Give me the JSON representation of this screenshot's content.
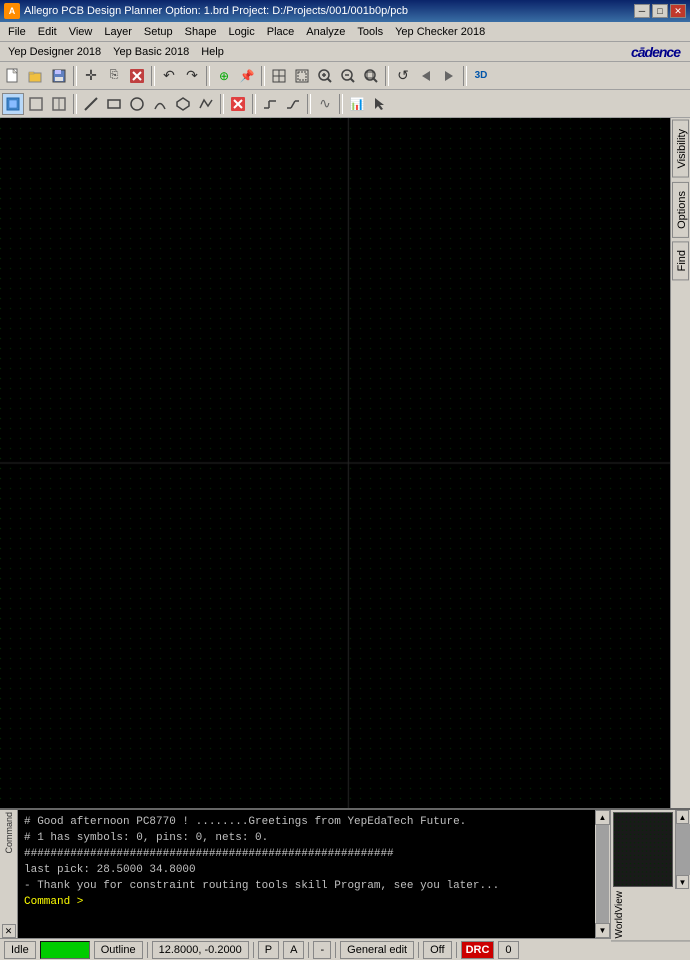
{
  "titlebar": {
    "title": "Allegro PCB Design Planner Option: 1.brd  Project: D:/Projects/001/001b0p/pcb",
    "icon_label": "A",
    "btn_minimize": "─",
    "btn_maximize": "□",
    "btn_close": "✕"
  },
  "menubar1": {
    "items": [
      "File",
      "Edit",
      "View",
      "Layer",
      "Setup",
      "Shape",
      "Logic",
      "Place",
      "Analyze",
      "Tools",
      "Yep Checker 2018"
    ]
  },
  "menubar2": {
    "items": [
      "Yep Designer 2018",
      "Yep Basic 2018",
      "Help"
    ],
    "logo": "cādence"
  },
  "toolbar1": {
    "buttons": [
      {
        "name": "new-btn",
        "icon": "📄",
        "label": "New"
      },
      {
        "name": "open-btn",
        "icon": "📂",
        "label": "Open"
      },
      {
        "name": "save-btn",
        "icon": "💾",
        "label": "Save"
      },
      {
        "name": "sep1",
        "icon": "",
        "label": ""
      },
      {
        "name": "move-btn",
        "icon": "✛",
        "label": "Move"
      },
      {
        "name": "copy-btn",
        "icon": "⎘",
        "label": "Copy"
      },
      {
        "name": "delete-btn",
        "icon": "✕",
        "label": "Delete"
      },
      {
        "name": "sep2",
        "icon": "",
        "label": ""
      },
      {
        "name": "undo-btn",
        "icon": "↶",
        "label": "Undo"
      },
      {
        "name": "redo-btn",
        "icon": "↷",
        "label": "Redo"
      },
      {
        "name": "sep3",
        "icon": "",
        "label": ""
      },
      {
        "name": "snap-btn",
        "icon": "⊕",
        "label": "Snap"
      },
      {
        "name": "pin-btn",
        "icon": "📌",
        "label": "Pin"
      },
      {
        "name": "sep4",
        "icon": "",
        "label": ""
      },
      {
        "name": "zoom-fit-btn",
        "icon": "⊞",
        "label": "Zoom Fit"
      },
      {
        "name": "zoom-in2-btn",
        "icon": "⊡",
        "label": "Zoom In"
      },
      {
        "name": "zoom-in-btn",
        "icon": "🔍+",
        "label": "Zoom In"
      },
      {
        "name": "zoom-out-btn",
        "icon": "🔍-",
        "label": "Zoom Out"
      },
      {
        "name": "zoom-area-btn",
        "icon": "⊠",
        "label": "Zoom Area"
      },
      {
        "name": "sep5",
        "icon": "",
        "label": ""
      },
      {
        "name": "redraw-btn",
        "icon": "↺",
        "label": "Redraw"
      },
      {
        "name": "prev-view-btn",
        "icon": "◁",
        "label": "Previous View"
      },
      {
        "name": "next-view-btn",
        "icon": "▷",
        "label": "Next View"
      },
      {
        "name": "sep6",
        "icon": "",
        "label": ""
      },
      {
        "name": "3d-btn",
        "icon": "3D",
        "label": "3D View"
      }
    ]
  },
  "toolbar2": {
    "buttons": [
      {
        "name": "select-active-btn",
        "icon": "▣",
        "label": "Select",
        "active": true
      },
      {
        "name": "select2-btn",
        "icon": "□",
        "label": "Select2"
      },
      {
        "name": "select3-btn",
        "icon": "◫",
        "label": "Select3"
      },
      {
        "name": "sep1",
        "icon": "",
        "label": ""
      },
      {
        "name": "line-btn",
        "icon": "╱",
        "label": "Line"
      },
      {
        "name": "rect-btn",
        "icon": "▭",
        "label": "Rectangle"
      },
      {
        "name": "circle-btn",
        "icon": "○",
        "label": "Circle"
      },
      {
        "name": "arc-btn",
        "icon": "⌒",
        "label": "Arc"
      },
      {
        "name": "shape-btn",
        "icon": "⬜",
        "label": "Shape"
      },
      {
        "name": "path-btn",
        "icon": "⤴",
        "label": "Path"
      },
      {
        "name": "sep2",
        "icon": "",
        "label": ""
      },
      {
        "name": "cut-btn",
        "icon": "✂",
        "label": "Cut"
      },
      {
        "name": "sep3",
        "icon": "",
        "label": ""
      },
      {
        "name": "route-btn",
        "icon": "→",
        "label": "Route"
      },
      {
        "name": "route2-btn",
        "icon": "↗",
        "label": "Route2"
      },
      {
        "name": "sep4",
        "icon": "",
        "label": ""
      },
      {
        "name": "wave-btn",
        "icon": "∿",
        "label": "Wave"
      },
      {
        "name": "sep5",
        "icon": "",
        "label": ""
      },
      {
        "name": "chart-btn",
        "icon": "📊",
        "label": "Chart"
      },
      {
        "name": "cursor-btn",
        "icon": "⌶",
        "label": "Cursor"
      }
    ]
  },
  "canvas": {
    "background": "#000000",
    "grid_color": "#003300"
  },
  "right_sidebar": {
    "tabs": [
      "Visibility",
      "Options",
      "Find"
    ]
  },
  "console": {
    "lines": [
      "# Good afternoon PC8770 !      ........Greetings from YepEdaTech Future.",
      "# 1 has symbols: 0, pins: 0, nets: 0.",
      "########################################################",
      "last pick:  28.5000 34.8000",
      "- Thank you for constraint routing tools skill Program, see you later...",
      "Command >"
    ],
    "label": "Command"
  },
  "statusbar": {
    "idle_label": "Idle",
    "idle_status": "",
    "outline_label": "Outline",
    "coordinates": "12.8000, -0.2000",
    "p_label": "P",
    "a_label": "A",
    "dash_label": "-",
    "edit_mode": "General edit",
    "off_label": "Off",
    "drc_label": "DRC",
    "drc_count": "0"
  },
  "worldview": {
    "label": "WorldView"
  }
}
